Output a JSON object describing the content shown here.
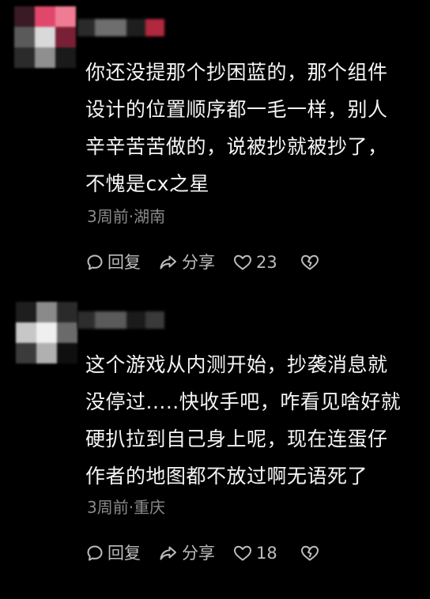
{
  "comments": [
    {
      "lines": [
        "你还没提那个抄困蓝的，那个组件",
        "设计的位置顺序都一毛一样，别人",
        "辛辛苦苦做的，说被抄就被抄了，",
        "不愧是cx之星"
      ],
      "meta": "3周前·湖南",
      "reply_label": "回复",
      "share_label": "分享",
      "likes": "23",
      "avatar_colors": [
        "#3a1a24",
        "#e0476b",
        "#f07c94",
        "#5a5a5a",
        "#d9d9d9",
        "#7a2036",
        "#2b2b2b",
        "#8f8f8f",
        "#1a1a1a"
      ],
      "name_colors": [
        "#2a2a2a",
        "#6e6e6e",
        "#1e1e1e",
        "#b2283f"
      ]
    },
    {
      "lines": [
        "这个游戏从内测开始，抄袭消息就",
        "没停过.....快收手吧，咋看见啥好就",
        "硬扒拉到自己身上呢，现在连蛋仔",
        "作者的地图都不放过啊无语死了"
      ],
      "meta": "3周前·重庆",
      "reply_label": "回复",
      "share_label": "分享",
      "likes": "18",
      "avatar_colors": [
        "#1e1e1e",
        "#8a8a8a",
        "#2a2a2a",
        "#c7c7c7",
        "#efefef",
        "#6a6a6a",
        "#3b3b3b",
        "#b0b0b0",
        "#0f0f0f"
      ],
      "name_colors": [
        "#2d2d2d",
        "#5a5a5a",
        "#1b1b1b",
        "#3a3a3a"
      ]
    }
  ],
  "icons": {
    "reply": "speech-bubble-icon",
    "share": "share-arrow-icon",
    "like": "heart-icon",
    "dislike": "broken-heart-icon"
  }
}
